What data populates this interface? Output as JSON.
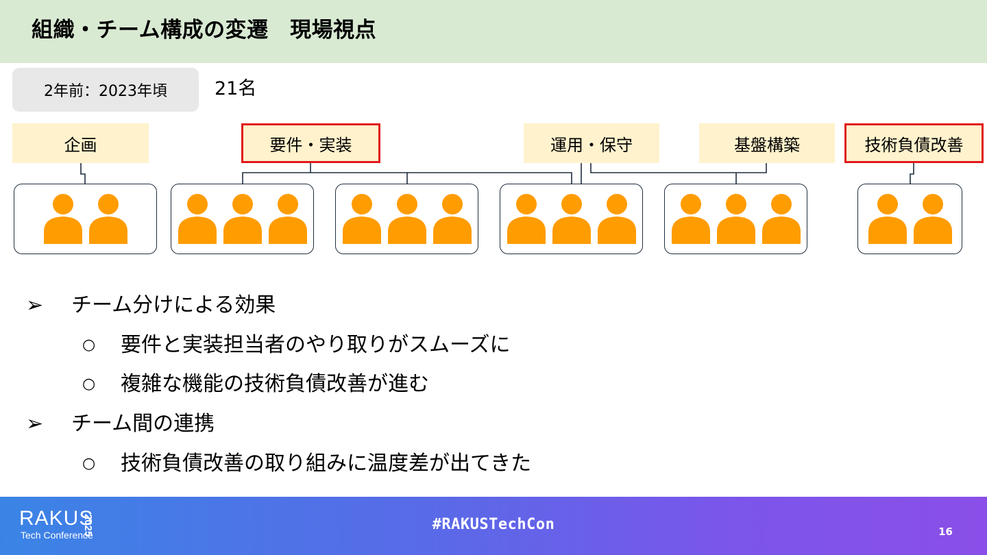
{
  "title": "組織・チーム構成の変遷　現場視点",
  "period": "2年前：2023年頃",
  "headcount": "21名",
  "team_labels": [
    {
      "name": "企画",
      "highlight": false
    },
    {
      "name": "要件・実装",
      "highlight": true
    },
    {
      "name": "運用・保守",
      "highlight": false
    },
    {
      "name": "基盤構築",
      "highlight": false
    },
    {
      "name": "技術負債改善",
      "highlight": true
    }
  ],
  "teams": [
    {
      "members": 2
    },
    {
      "members": 3
    },
    {
      "members": 3
    },
    {
      "members": 3
    },
    {
      "members": 3
    },
    {
      "members": 2
    }
  ],
  "person_color": "#ff9c00",
  "highlight_color": "#e0181b",
  "bullets": [
    {
      "level": 1,
      "marker": "➢",
      "text": "チーム分けによる効果"
    },
    {
      "level": 2,
      "marker": "○",
      "text": "要件と実装担当者のやり取りがスムーズに"
    },
    {
      "level": 2,
      "marker": "○",
      "text": "複雑な機能の技術負債改善が進む"
    },
    {
      "level": 1,
      "marker": "➢",
      "text": "チーム間の連携"
    },
    {
      "level": 2,
      "marker": "○",
      "text": "技術負債改善の取り組みに温度差が出てきた"
    }
  ],
  "footer": {
    "logo": "RAKUS",
    "logo_sub": "Tech Conference",
    "logo_year": "2025",
    "hashtag": "#RAKUSTechCon",
    "page_number": "16"
  }
}
